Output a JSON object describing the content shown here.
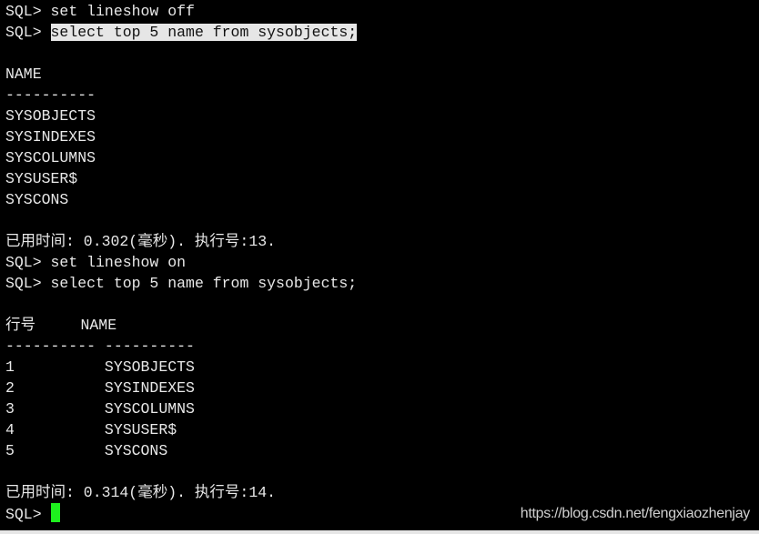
{
  "terminal": {
    "prompt": "SQL> ",
    "lines": [
      {
        "prompt": "SQL> ",
        "text": "set lineshow off"
      },
      {
        "prompt": "SQL> ",
        "text": "select top 5 name from sysobjects;",
        "selected": true
      },
      {
        "text": ""
      },
      {
        "text": "NAME"
      },
      {
        "text": "----------"
      },
      {
        "text": "SYSOBJECTS"
      },
      {
        "text": "SYSINDEXES"
      },
      {
        "text": "SYSCOLUMNS"
      },
      {
        "text": "SYSUSER$"
      },
      {
        "text": "SYSCONS"
      },
      {
        "text": ""
      },
      {
        "text": "已用时间: 0.302(毫秒). 执行号:13."
      },
      {
        "prompt": "SQL> ",
        "text": "set lineshow on"
      },
      {
        "prompt": "SQL> ",
        "text": "select top 5 name from sysobjects;"
      },
      {
        "text": ""
      },
      {
        "text": "行号     NAME"
      },
      {
        "text": "---------- ----------"
      },
      {
        "text": "1          SYSOBJECTS"
      },
      {
        "text": "2          SYSINDEXES"
      },
      {
        "text": "3          SYSCOLUMNS"
      },
      {
        "text": "4          SYSUSER$"
      },
      {
        "text": "5          SYSCONS"
      },
      {
        "text": ""
      },
      {
        "text": "已用时间: 0.314(毫秒). 执行号:14."
      }
    ],
    "cursor_color": "#1ef01e"
  },
  "watermark": "https://blog.csdn.net/fengxiaozhenjay"
}
